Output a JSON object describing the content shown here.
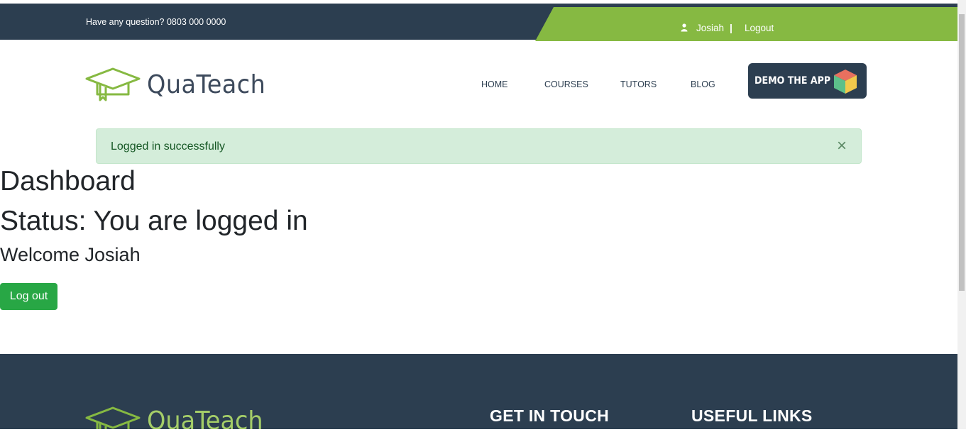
{
  "topbar": {
    "question_text": "Have any question? 0803 000 0000",
    "user_name": "Josiah",
    "separator": "|",
    "logout_label": "Logout",
    "bg_color": "#2c3e50",
    "accent_color": "#86b942"
  },
  "brand": {
    "name": "QuaTeach",
    "icon": "graduation-cap-icon"
  },
  "nav": {
    "items": [
      {
        "label": "HOME"
      },
      {
        "label": "COURSES"
      },
      {
        "label": "TUTORS"
      },
      {
        "label": "BLOG"
      }
    ],
    "demo_label": "DEMO THE APP",
    "demo_icon": "cube-icon"
  },
  "alert": {
    "message": "Logged in successfully",
    "close_symbol": "×",
    "bg_color": "#d4edda"
  },
  "main": {
    "title": "Dashboard",
    "status": "Status: You are logged in",
    "welcome": "Welcome Josiah",
    "logout_button": "Log out",
    "button_color": "#28a745"
  },
  "footer": {
    "brand_name": "QuaTeach",
    "col1_heading": "GET IN TOUCH",
    "col2_heading": "USEFUL LINKS"
  }
}
